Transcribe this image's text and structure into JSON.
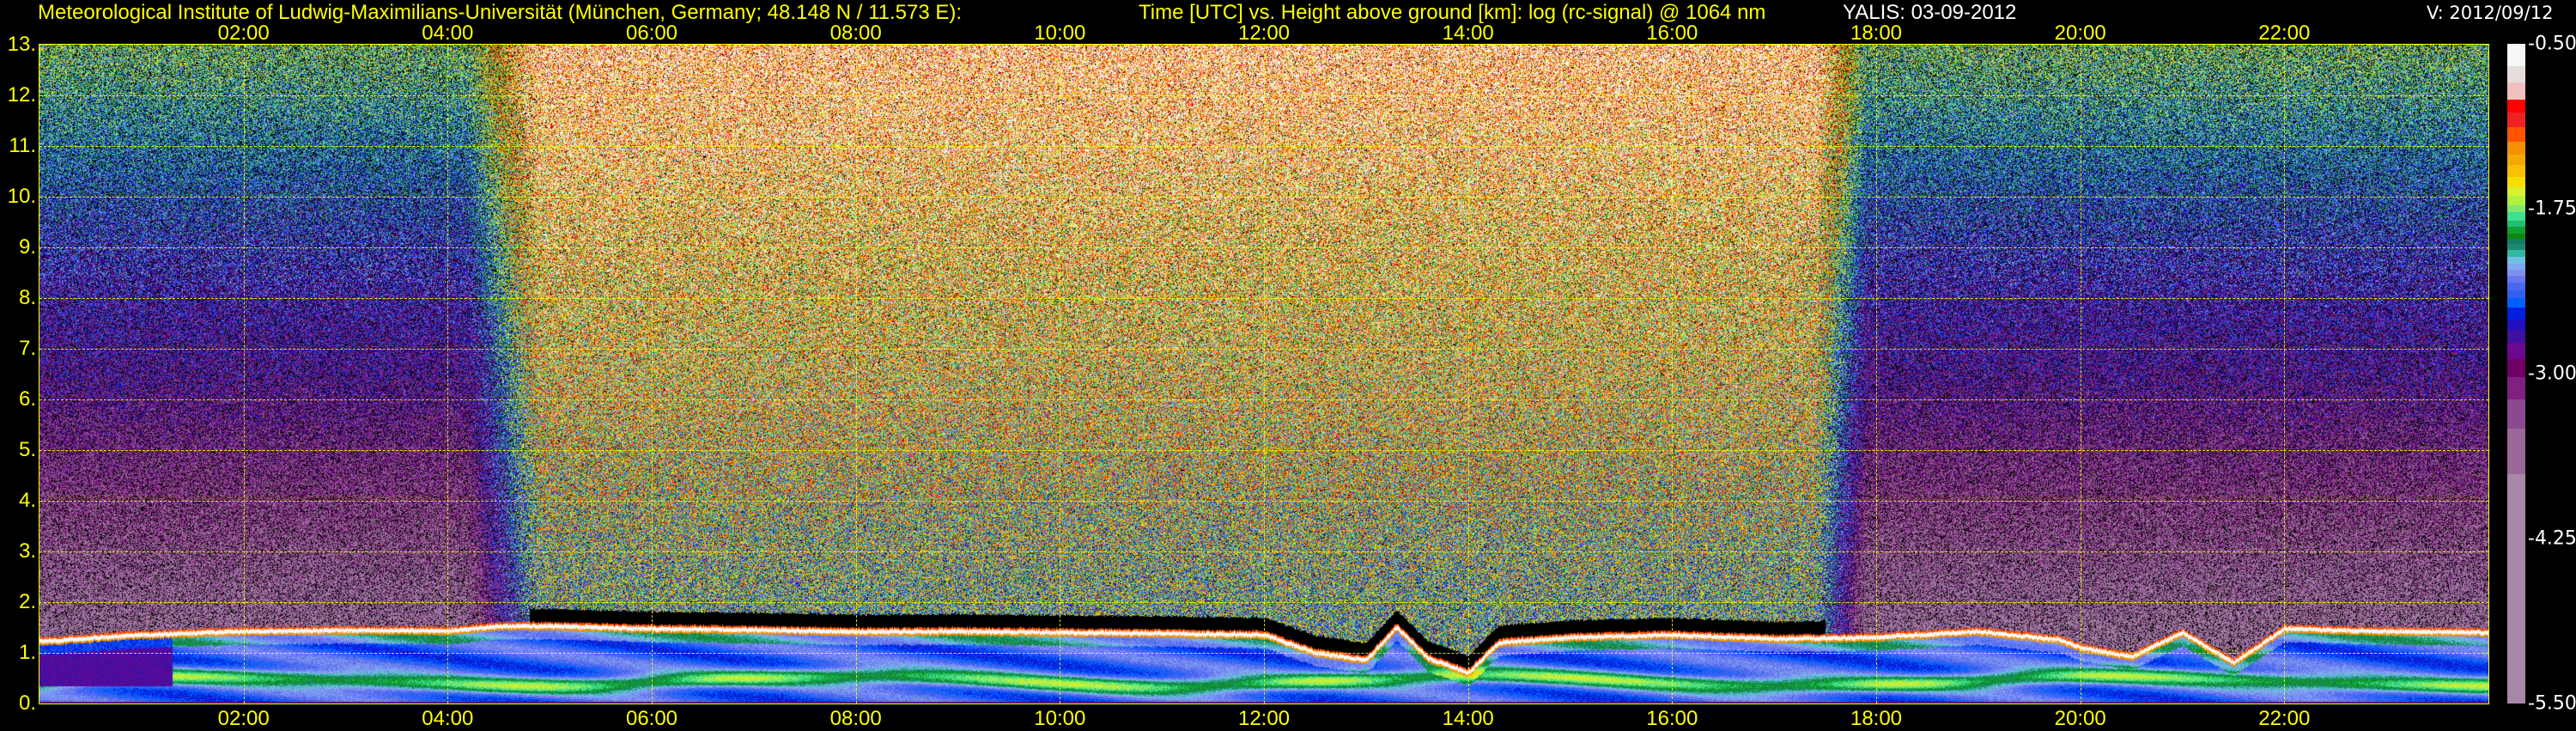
{
  "header": {
    "institute": "Meteorological Institute of Ludwig-Maximilians-Universität (München, Germany; 48.148 N / 11.573 E):",
    "plot_description": "Time [UTC] vs. Height above ground [km]: log (rc-signal) @ 1064 nm",
    "instrument_date": "YALIS: 03-09-2012",
    "version": "V: 2012/09/12"
  },
  "chart_data": {
    "type": "heatmap",
    "title": "Time [UTC] vs. Height above ground [km]: log (rc-signal) @ 1064 nm",
    "xlabel": "Time [UTC]",
    "ylabel": "Height above ground [km]",
    "xlim_hours": [
      0,
      24
    ],
    "ylim_km": [
      0,
      13
    ],
    "x_ticks": [
      "02:00",
      "04:00",
      "06:00",
      "08:00",
      "10:00",
      "12:00",
      "14:00",
      "16:00",
      "18:00",
      "20:00",
      "22:00"
    ],
    "x_tick_hours": [
      2,
      4,
      6,
      8,
      10,
      12,
      14,
      16,
      18,
      20,
      22
    ],
    "y_ticks": [
      "13.",
      "12.",
      "11.",
      "10.",
      "9.",
      "8.",
      "7.",
      "6.",
      "5.",
      "4.",
      "3.",
      "2.",
      "1.",
      "0."
    ],
    "y_tick_values": [
      13,
      12,
      11,
      10,
      9,
      8,
      7,
      6,
      5,
      4,
      3,
      2,
      1,
      0
    ],
    "grid": true,
    "colorbar": {
      "range": [
        -5.5,
        -0.5
      ],
      "tick_labels": [
        "-0.50",
        "-1.75",
        "-3.00",
        "-4.25",
        "-5.50"
      ],
      "tick_values": [
        -0.5,
        -1.75,
        -3.0,
        -4.25,
        -5.5
      ],
      "colors": [
        "#f6f6f6",
        "#e6dcdc",
        "#f0c0c0",
        "#ff0000",
        "#ee2222",
        "#ff5500",
        "#f59000",
        "#f5a800",
        "#f8c000",
        "#f8dd00",
        "#d8f030",
        "#b0f040",
        "#80e870",
        "#40e090",
        "#20c070",
        "#10a030",
        "#108810",
        "#108060",
        "#208870",
        "#30b8a0",
        "#70c0e0",
        "#80a8f0",
        "#8090f0",
        "#6878f0",
        "#4868f0",
        "#3060f0",
        "#0060ff",
        "#0020e0",
        "#2010c0",
        "#4010a0",
        "#6a0890",
        "#700068",
        "#802080",
        "#8c4890",
        "#9a6898",
        "#a888a8"
      ],
      "lower_bounds": [
        -0.669,
        -0.792,
        -0.923,
        -1.021,
        -1.134,
        -1.239,
        -1.338,
        -1.415,
        -1.507,
        -1.585,
        -1.655,
        -1.725,
        -1.778,
        -1.838,
        -1.884,
        -1.937,
        -1.979,
        -2.014,
        -2.06,
        -2.113,
        -2.165,
        -2.211,
        -2.261,
        -2.31,
        -2.366,
        -2.43,
        -2.5,
        -2.588,
        -2.669,
        -2.764,
        -2.887,
        -3.028,
        -3.197,
        -3.415,
        -3.761,
        -5.5
      ]
    },
    "boundary_layer_top": {
      "hours": [
        0,
        1,
        2,
        3,
        4,
        4.5,
        5,
        6,
        7,
        8,
        9,
        10,
        11,
        12,
        12.5,
        13,
        13.3,
        13.6,
        14,
        14.3,
        15,
        16,
        17,
        18,
        19,
        19.8,
        20,
        20.5,
        21,
        21.5,
        22,
        23,
        24
      ],
      "height_km": [
        1.22,
        1.35,
        1.42,
        1.44,
        1.43,
        1.52,
        1.52,
        1.47,
        1.45,
        1.41,
        1.42,
        1.4,
        1.38,
        1.35,
        1.0,
        0.85,
        1.5,
        0.9,
        0.6,
        1.2,
        1.3,
        1.35,
        1.27,
        1.3,
        1.42,
        1.25,
        1.1,
        0.92,
        1.4,
        0.8,
        1.47,
        1.42,
        1.4
      ]
    },
    "daytime_high_noise_hours": [
      4.5,
      17.7
    ],
    "residual_black_gap_hours": [
      4.8,
      17.5
    ]
  }
}
